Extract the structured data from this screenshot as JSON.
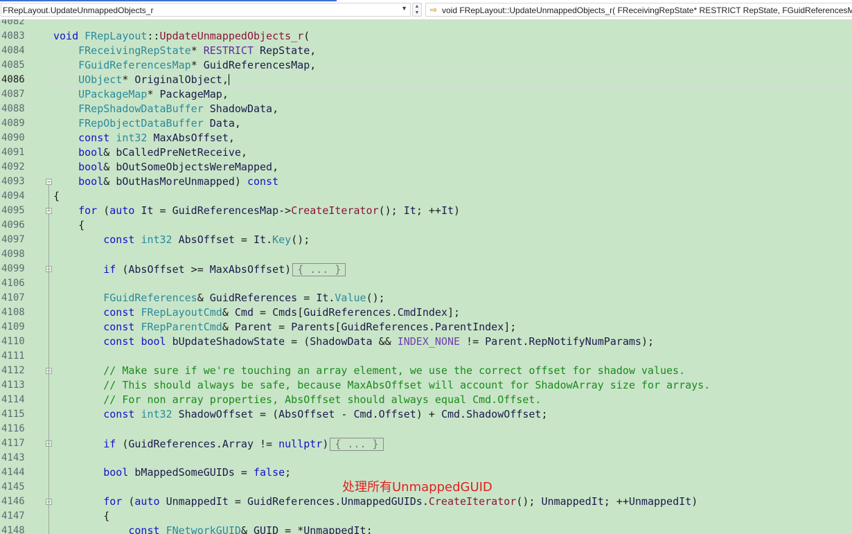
{
  "nav": {
    "scope_label": "FRepLayout.UpdateUnmappedObjects_r",
    "member_label": "void FRepLayout::UpdateUnmappedObjects_r( FReceivingRepState* RESTRICT RepState, FGuidReferencesMap* GuidReferencesMap, UObject* OriginalObject, UPackageMap* PackageMap"
  },
  "editor": {
    "current_line": "4086",
    "annotation": "处理所有UnmappedGUID",
    "lines": [
      {
        "n": "4082",
        "fold": "",
        "code": ""
      },
      {
        "n": "4083",
        "fold": "",
        "code": "void FRepLayout::UpdateUnmappedObjects_r("
      },
      {
        "n": "4084",
        "fold": "",
        "code": "    FReceivingRepState* RESTRICT RepState,"
      },
      {
        "n": "4085",
        "fold": "",
        "code": "    FGuidReferencesMap* GuidReferencesMap,"
      },
      {
        "n": "4086",
        "fold": "",
        "code": "    UObject* OriginalObject,"
      },
      {
        "n": "4087",
        "fold": "",
        "code": "    UPackageMap* PackageMap,"
      },
      {
        "n": "4088",
        "fold": "",
        "code": "    FRepShadowDataBuffer ShadowData,"
      },
      {
        "n": "4089",
        "fold": "",
        "code": "    FRepObjectDataBuffer Data,"
      },
      {
        "n": "4090",
        "fold": "",
        "code": "    const int32 MaxAbsOffset,"
      },
      {
        "n": "4091",
        "fold": "",
        "code": "    bool& bCalledPreNetReceive,"
      },
      {
        "n": "4092",
        "fold": "",
        "code": "    bool& bOutSomeObjectsWereMapped,"
      },
      {
        "n": "4093",
        "fold": "minus",
        "code": "    bool& bOutHasMoreUnmapped) const"
      },
      {
        "n": "4094",
        "fold": "",
        "code": "{"
      },
      {
        "n": "4095",
        "fold": "minus",
        "code": "    for (auto It = GuidReferencesMap->CreateIterator(); It; ++It)"
      },
      {
        "n": "4096",
        "fold": "",
        "code": "    {"
      },
      {
        "n": "4097",
        "fold": "",
        "code": "        const int32 AbsOffset = It.Key();"
      },
      {
        "n": "4098",
        "fold": "",
        "code": ""
      },
      {
        "n": "4099",
        "fold": "plus",
        "code": "        if (AbsOffset >= MaxAbsOffset)",
        "collapsed": "{ ... }"
      },
      {
        "n": "4106",
        "fold": "",
        "code": ""
      },
      {
        "n": "4107",
        "fold": "",
        "code": "        FGuidReferences& GuidReferences = It.Value();"
      },
      {
        "n": "4108",
        "fold": "",
        "code": "        const FRepLayoutCmd& Cmd = Cmds[GuidReferences.CmdIndex];"
      },
      {
        "n": "4109",
        "fold": "",
        "code": "        const FRepParentCmd& Parent = Parents[GuidReferences.ParentIndex];"
      },
      {
        "n": "4110",
        "fold": "",
        "code": "        const bool bUpdateShadowState = (ShadowData && INDEX_NONE != Parent.RepNotifyNumParams);"
      },
      {
        "n": "4111",
        "fold": "",
        "code": ""
      },
      {
        "n": "4112",
        "fold": "minus",
        "code": "        // Make sure if we're touching an array element, we use the correct offset for shadow values."
      },
      {
        "n": "4113",
        "fold": "",
        "code": "        // This should always be safe, because MaxAbsOffset will account for ShadowArray size for arrays."
      },
      {
        "n": "4114",
        "fold": "",
        "code": "        // For non array properties, AbsOffset should always equal Cmd.Offset."
      },
      {
        "n": "4115",
        "fold": "",
        "code": "        const int32 ShadowOffset = (AbsOffset - Cmd.Offset) + Cmd.ShadowOffset;"
      },
      {
        "n": "4116",
        "fold": "",
        "code": ""
      },
      {
        "n": "4117",
        "fold": "plus",
        "code": "        if (GuidReferences.Array != nullptr)",
        "collapsed": "{ ... }"
      },
      {
        "n": "4143",
        "fold": "",
        "code": ""
      },
      {
        "n": "4144",
        "fold": "",
        "code": "        bool bMappedSomeGUIDs = false;"
      },
      {
        "n": "4145",
        "fold": "",
        "code": ""
      },
      {
        "n": "4146",
        "fold": "minus",
        "code": "        for (auto UnmappedIt = GuidReferences.UnmappedGUIDs.CreateIterator(); UnmappedIt; ++UnmappedIt)"
      },
      {
        "n": "4147",
        "fold": "",
        "code": "        {"
      },
      {
        "n": "4148",
        "fold": "",
        "code": "            const FNetworkGUID& GUID = *UnmappedIt;"
      }
    ]
  },
  "colors": {
    "background": "#c9e5c8",
    "keyword": "#1212c8",
    "type": "#2b8a9a",
    "function": "#8a1538",
    "comment": "#1a8a1a",
    "annotation": "#e02020"
  }
}
